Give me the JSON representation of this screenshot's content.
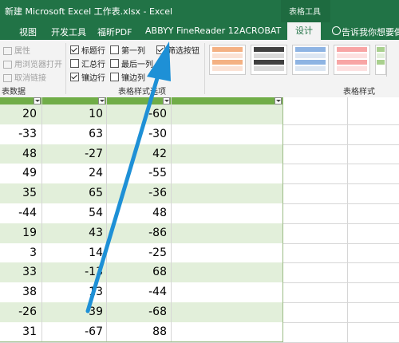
{
  "window": {
    "title": "新建 Microsoft Excel 工作表.xlsx  -  Excel",
    "context_tab_title": "表格工具"
  },
  "ribbon_tabs": [
    "视图",
    "开发工具",
    "福昕PDF",
    "ABBYY FineReader 12",
    "ACROBAT",
    "设计"
  ],
  "tell_me": "告诉我你想要做",
  "ribbon": {
    "external_data": {
      "items": [
        "属性",
        "用浏览器打开",
        "取消链接"
      ],
      "group_label": "表数据"
    },
    "style_options": {
      "checkboxes": [
        {
          "label": "标题行",
          "checked": true
        },
        {
          "label": "第一列",
          "checked": false
        },
        {
          "label": "筛选按钮",
          "checked": true
        },
        {
          "label": "汇总行",
          "checked": false
        },
        {
          "label": "最后一列",
          "checked": false
        },
        {
          "label": "镶边行",
          "checked": true
        },
        {
          "label": "镶边列",
          "checked": false
        }
      ],
      "group_label": "表格样式选项"
    },
    "table_styles": {
      "group_label": "表格样式",
      "swatch_colors": [
        "#f4b183",
        "#404040",
        "#8eb4e3",
        "#f8a5a5",
        "#a9d08e"
      ]
    }
  },
  "sheet": {
    "header_color": "#70ad47",
    "band_color": "#e2efda",
    "header_labels": [
      "表数据",
      "",
      "表格样式选项",
      ""
    ],
    "rows": [
      [
        "20",
        "10",
        "-60"
      ],
      [
        "-33",
        "63",
        "-30"
      ],
      [
        "48",
        "-27",
        "42"
      ],
      [
        "49",
        "24",
        "-55"
      ],
      [
        "35",
        "65",
        "-36"
      ],
      [
        "-44",
        "54",
        "48"
      ],
      [
        "19",
        "43",
        "-86"
      ],
      [
        "3",
        "14",
        "-25"
      ],
      [
        "33",
        "-13",
        "68"
      ],
      [
        "38",
        "13",
        "-44"
      ],
      [
        "-26",
        "39",
        "-68"
      ],
      [
        "31",
        "-67",
        "88"
      ]
    ]
  },
  "annotation": {
    "arrow_color": "#1e90d6"
  }
}
